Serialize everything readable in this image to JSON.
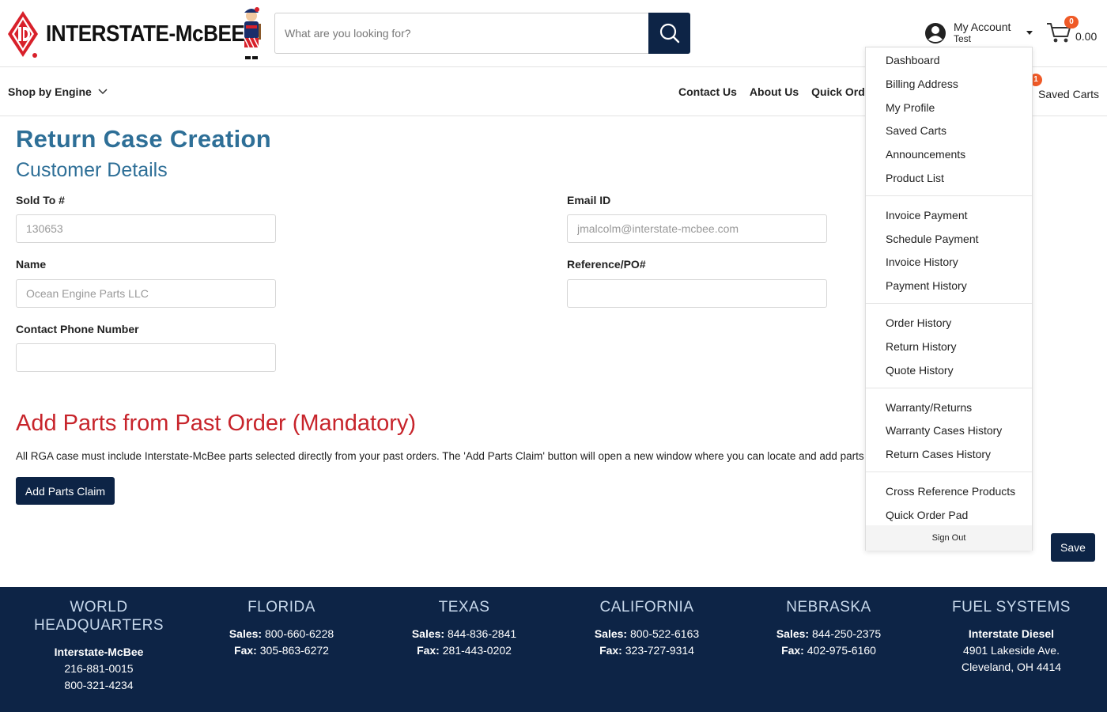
{
  "header": {
    "brand": "INTERSTATE-McBEE",
    "search_placeholder": "What are you looking for?",
    "account_title": "My Account",
    "account_user": "Test",
    "cart_count": "0",
    "cart_total": "0.00",
    "brand_red": "#d8202a",
    "navy": "#0d2446"
  },
  "nav": {
    "shop_by_engine": "Shop by Engine",
    "links": [
      "Contact Us",
      "About Us",
      "Quick Order"
    ],
    "saved_carts_badge": "1",
    "saved_carts": "Saved Carts"
  },
  "main": {
    "page_title": "Return Case Creation",
    "section_title": "Customer Details",
    "sold_to_label": "Sold To #",
    "sold_to_value": "130653",
    "email_label": "Email ID",
    "email_value": "jmalcolm@interstate-mcbee.com",
    "name_label": "Name",
    "name_value": "Ocean Engine Parts LLC",
    "reference_label": "Reference/PO#",
    "reference_value": "",
    "phone_label": "Contact Phone Number",
    "phone_value": "",
    "parts_title": "Add Parts from Past Order (Mandatory)",
    "parts_desc": "All RGA case must include Interstate-McBee parts selected directly from your past orders. The 'Add Parts Claim' button will open a new window where you can locate and add parts from your past orders.",
    "add_parts_button": "Add Parts Claim",
    "save_button": "Save"
  },
  "dropdown": {
    "groups": [
      [
        "Dashboard",
        "Billing Address",
        "My Profile",
        "Saved Carts",
        "Announcements",
        "Product List"
      ],
      [
        "Invoice Payment",
        "Schedule Payment",
        "Invoice History",
        "Payment History"
      ],
      [
        "Order History",
        "Return History",
        "Quote History"
      ],
      [
        "Warranty/Returns",
        "Warranty Cases History",
        "Return Cases History"
      ],
      [
        "Cross Reference Products",
        "Quick Order Pad"
      ]
    ],
    "sign_out": "Sign Out"
  },
  "footer": {
    "columns": [
      {
        "heading": [
          "WORLD",
          "HEADQUARTERS"
        ],
        "lines": [
          {
            "bold": "Interstate-McBee",
            "text": ""
          },
          {
            "bold": "",
            "text": "216-881-0015"
          },
          {
            "bold": "",
            "text": "800-321-4234"
          }
        ]
      },
      {
        "heading": [
          "FLORIDA"
        ],
        "lines": [
          {
            "bold": "Sales:",
            "text": " 800-660-6228"
          },
          {
            "bold": "Fax:",
            "text": " 305-863-6272"
          }
        ]
      },
      {
        "heading": [
          "TEXAS"
        ],
        "lines": [
          {
            "bold": "Sales:",
            "text": " 844-836-2841"
          },
          {
            "bold": "Fax:",
            "text": " 281-443-0202"
          }
        ]
      },
      {
        "heading": [
          "CALIFORNIA"
        ],
        "lines": [
          {
            "bold": "Sales:",
            "text": " 800-522-6163"
          },
          {
            "bold": "Fax:",
            "text": " 323-727-9314"
          }
        ]
      },
      {
        "heading": [
          "NEBRASKA"
        ],
        "lines": [
          {
            "bold": "Sales:",
            "text": " 844-250-2375"
          },
          {
            "bold": "Fax:",
            "text": " 402-975-6160"
          }
        ]
      },
      {
        "heading": [
          "FUEL SYSTEMS"
        ],
        "lines": [
          {
            "bold": "Interstate Diesel",
            "text": ""
          },
          {
            "bold": "",
            "text": "4901 Lakeside Ave."
          },
          {
            "bold": "",
            "text": "Cleveland, OH 4414"
          }
        ]
      }
    ]
  }
}
